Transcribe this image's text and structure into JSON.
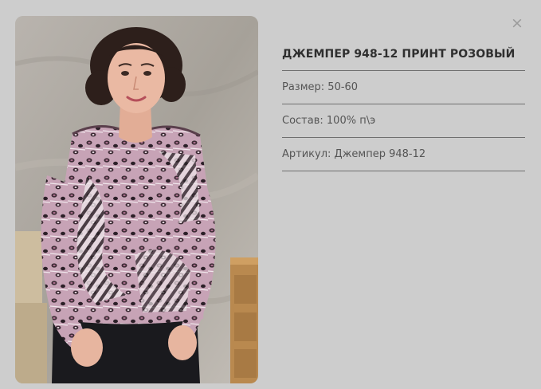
{
  "modal": {
    "close_label": "×"
  },
  "product": {
    "title": "ДЖЕМПЕР 948-12 ПРИНТ РОЗОВЫЙ",
    "size_label": "Размер:",
    "size_value": "50-60",
    "composition_label": "Состав:",
    "composition_value": "100% п\\э",
    "article_label": "Артикул:",
    "article_value": "Джемпер 948-12"
  },
  "colors": {
    "background": "#cdcdcd",
    "divider": "#6f6f6f",
    "title": "#2f2f2f",
    "text": "#555555"
  }
}
